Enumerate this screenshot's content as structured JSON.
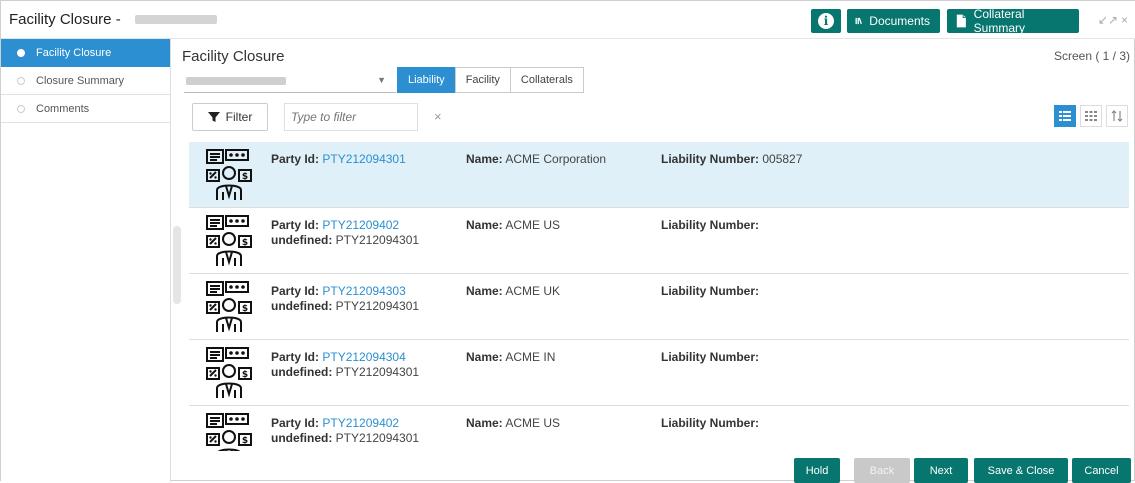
{
  "window": {
    "title": "Facility Closure -",
    "info_label": "i",
    "documents_label": "Documents",
    "collateral_summary_label": "Collateral Summary",
    "minimize_label": "↙↗",
    "close_label": "×"
  },
  "sidebar": {
    "items": [
      {
        "label": "Facility Closure",
        "active": true
      },
      {
        "label": "Closure Summary",
        "active": false
      },
      {
        "label": "Comments",
        "active": false
      }
    ]
  },
  "main": {
    "title": "Facility Closure",
    "screen_indicator": "Screen ( 1 / 3)",
    "tabs": [
      {
        "label": "Liability",
        "active": true
      },
      {
        "label": "Facility",
        "active": false
      },
      {
        "label": "Collaterals",
        "active": false
      }
    ],
    "filter_label": "Filter",
    "filter_placeholder": "Type to filter",
    "filter_clear": "×"
  },
  "labels": {
    "party_id": "Party Id:",
    "undefined": "undefined:",
    "name": "Name:",
    "liability_number": "Liability Number:"
  },
  "rows": [
    {
      "party_id": "PTY212094301",
      "undefined": "",
      "name": "ACME Corporation",
      "liability_number": "005827",
      "selected": true
    },
    {
      "party_id": "PTY21209402",
      "undefined": "PTY212094301",
      "name": "ACME US",
      "liability_number": "",
      "selected": false
    },
    {
      "party_id": "PTY212094303",
      "undefined": "PTY212094301",
      "name": "ACME UK",
      "liability_number": "",
      "selected": false
    },
    {
      "party_id": "PTY212094304",
      "undefined": "PTY212094301",
      "name": "ACME IN",
      "liability_number": "",
      "selected": false
    },
    {
      "party_id": "PTY21209402",
      "undefined": "PTY212094301",
      "name": "ACME US",
      "liability_number": "",
      "selected": false
    }
  ],
  "footer": {
    "hold_label": "Hold",
    "back_label": "Back",
    "next_label": "Next",
    "save_close_label": "Save & Close",
    "cancel_label": "Cancel"
  },
  "colors": {
    "accent_teal": "#06766f",
    "accent_blue": "#2b8fd1",
    "selected_row": "#dff0f8"
  }
}
